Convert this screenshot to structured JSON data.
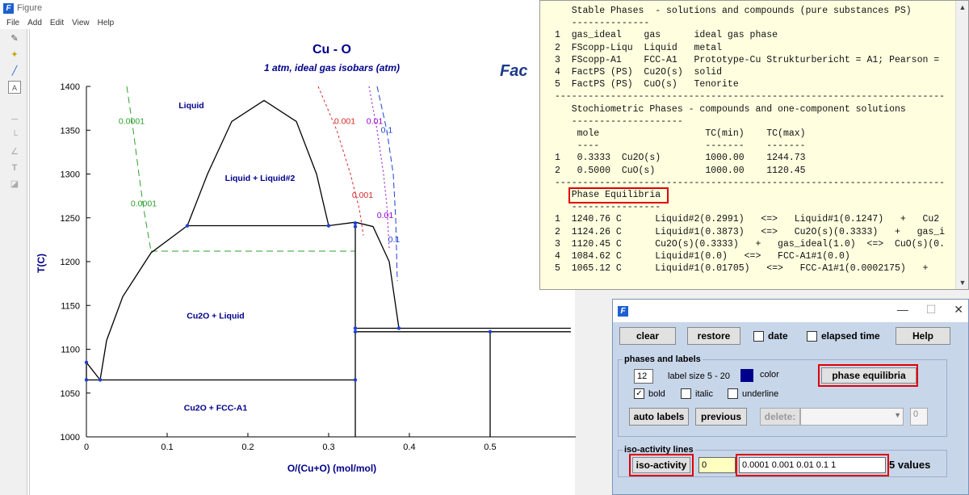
{
  "figure_window": {
    "title": "Figure",
    "menu": [
      "File",
      "Add",
      "Edit",
      "View",
      "Help"
    ],
    "logo_text": "Fac",
    "chart_title": "Cu - O",
    "chart_subtitle": "1 atm, ideal gas isobars (atm)"
  },
  "chart_data": {
    "type": "phase_diagram",
    "title": "Cu - O",
    "subtitle": "1 atm, ideal gas isobars (atm)",
    "xlabel": "O/(Cu+O) (mol/mol)",
    "ylabel": "T(C)",
    "xlim": [
      0,
      0.6
    ],
    "ylim": [
      1000,
      1400
    ],
    "xticks": [
      "0",
      "0.1",
      "0.2",
      "0.3",
      "0.4",
      "0.5"
    ],
    "yticks": [
      "1000",
      "1050",
      "1100",
      "1150",
      "1200",
      "1250",
      "1300",
      "1350",
      "1400"
    ],
    "region_labels": [
      "Liquid",
      "Liquid + Liquid#2",
      "Cu2O + Liquid",
      "Cu2O + FCC-A1"
    ],
    "isobar_labels": [
      "0.0001",
      "0.0001",
      "0.001",
      "0.001",
      "0.01",
      "0.01",
      "0.1",
      "0.1"
    ],
    "phase_boundaries": [
      {
        "name": "liquid-miscibility-gap",
        "points": [
          [
            0.125,
            1241
          ],
          [
            0.15,
            1300
          ],
          [
            0.18,
            1360
          ],
          [
            0.22,
            1384
          ],
          [
            0.26,
            1360
          ],
          [
            0.285,
            1300
          ],
          [
            0.3,
            1241
          ]
        ]
      },
      {
        "name": "liquidus-cu2o",
        "points": [
          [
            0.017,
            1065
          ],
          [
            0.025,
            1110
          ],
          [
            0.045,
            1160
          ],
          [
            0.08,
            1210
          ],
          [
            0.125,
            1241
          ]
        ]
      },
      {
        "name": "monotectic-line",
        "points": [
          [
            0.125,
            1241
          ],
          [
            0.3,
            1241
          ]
        ]
      },
      {
        "name": "liquid2-right",
        "points": [
          [
            0.3,
            1241
          ],
          [
            0.333,
            1245
          ],
          [
            0.355,
            1240
          ],
          [
            0.375,
            1200
          ],
          [
            0.387,
            1124
          ]
        ]
      },
      {
        "name": "eutectic-line",
        "points": [
          [
            0,
            1065
          ],
          [
            0.333,
            1065
          ]
        ]
      },
      {
        "name": "cu2o-line",
        "points": [
          [
            0.333,
            1000
          ],
          [
            0.333,
            1244
          ]
        ]
      },
      {
        "name": "cu2o-cuo-eutectic",
        "points": [
          [
            0.333,
            1124
          ],
          [
            0.6,
            1124
          ]
        ]
      },
      {
        "name": "cuo-cu2o-line",
        "points": [
          [
            0.333,
            1120
          ],
          [
            0.6,
            1120
          ]
        ]
      },
      {
        "name": "cuo-line",
        "points": [
          [
            0.5,
            1000
          ],
          [
            0.5,
            1120
          ]
        ]
      },
      {
        "name": "cu-liquidus",
        "points": [
          [
            0,
            1085
          ],
          [
            0.017,
            1065
          ]
        ]
      },
      {
        "name": "cu-solidus",
        "points": [
          [
            0,
            1085
          ],
          [
            0,
            1065
          ]
        ]
      }
    ],
    "isobars": [
      {
        "name": "0.0001-upper",
        "color": "#2ca02c",
        "points": [
          [
            0.05,
            1400
          ],
          [
            0.058,
            1350
          ],
          [
            0.065,
            1300
          ],
          [
            0.071,
            1260
          ],
          [
            0.08,
            1212
          ]
        ]
      },
      {
        "name": "0.0001-lower",
        "color": "#2ca02c",
        "points": [
          [
            0.08,
            1212
          ],
          [
            0.333,
            1212
          ]
        ]
      },
      {
        "name": "0.001",
        "color": "#d62728",
        "points": [
          [
            0.287,
            1400
          ],
          [
            0.31,
            1350
          ],
          [
            0.327,
            1300
          ],
          [
            0.338,
            1260
          ],
          [
            0.343,
            1230
          ]
        ]
      },
      {
        "name": "0.01",
        "color": "#9400d3",
        "points": [
          [
            0.35,
            1400
          ],
          [
            0.36,
            1350
          ],
          [
            0.368,
            1300
          ],
          [
            0.372,
            1265
          ],
          [
            0.375,
            1215
          ]
        ]
      },
      {
        "name": "0.1",
        "color": "#1f3fd1",
        "points": [
          [
            0.36,
            1400
          ],
          [
            0.372,
            1350
          ],
          [
            0.38,
            1300
          ],
          [
            0.383,
            1250
          ],
          [
            0.385,
            1178
          ]
        ]
      }
    ]
  },
  "text_output": {
    "lines": [
      "   Stable Phases  - solutions and compounds (pure substances PS)",
      "   --------------",
      "1  gas_ideal    gas      ideal gas phase",
      "2  FScopp-Liqu  Liquid   metal",
      "3  FScopp-A1    FCC-A1   Prototype-Cu Strukturbericht = A1; Pearson =",
      "4  FactPS (PS)  Cu2O(s)  solid",
      "5  FactPS (PS)  CuO(s)   Tenorite",
      "----------------------------------------------------------------------",
      "   Stochiometric Phases - compounds and one-component solutions",
      "   --------------------",
      "    mole                   TC(min)    TC(max)",
      "    ----                   -------    -------",
      "1   0.3333  Cu2O(s)        1000.00    1244.73",
      "2   0.5000  CuO(s)         1000.00    1120.45",
      "----------------------------------------------------------------------",
      "   Phase Equilibria",
      "   ----------------",
      "1  1240.76 C      Liquid#2(0.2991)   <=>   Liquid#1(0.1247)   +   Cu2",
      "2  1124.26 C      Liquid#1(0.3873)   <=>   Cu2O(s)(0.3333)   +   gas_i",
      "3  1120.45 C      Cu2O(s)(0.3333)   +   gas_ideal(1.0)  <=>  CuO(s)(0.",
      "4  1084.62 C      Liquid#1(0.0)   <=>   FCC-A1#1(0.0)",
      "5  1065.12 C      Liquid#1(0.01705)   <=>   FCC-A1#1(0.0002175)   +"
    ]
  },
  "control_panel": {
    "clear": "clear",
    "restore": "restore",
    "date": "date",
    "elapsed_time": "elapsed time",
    "help": "Help",
    "phases_and_labels": "phases and labels",
    "label_size_value": "12",
    "label_size_text": "label size 5 - 20",
    "color": "color",
    "phase_equilibria": "phase equilibria",
    "bold": "bold",
    "italic": "italic",
    "underline": "underline",
    "auto_labels": "auto labels",
    "previous": "previous",
    "delete": "delete:",
    "delete_count": "0",
    "iso_activity_lines": "iso-activity lines",
    "iso_activity": "iso-activity",
    "iso_value": "0",
    "iso_values": "0.0001 0.001 0.01 0.1 1",
    "values_count": "5 values",
    "label_color": "#00008b"
  }
}
